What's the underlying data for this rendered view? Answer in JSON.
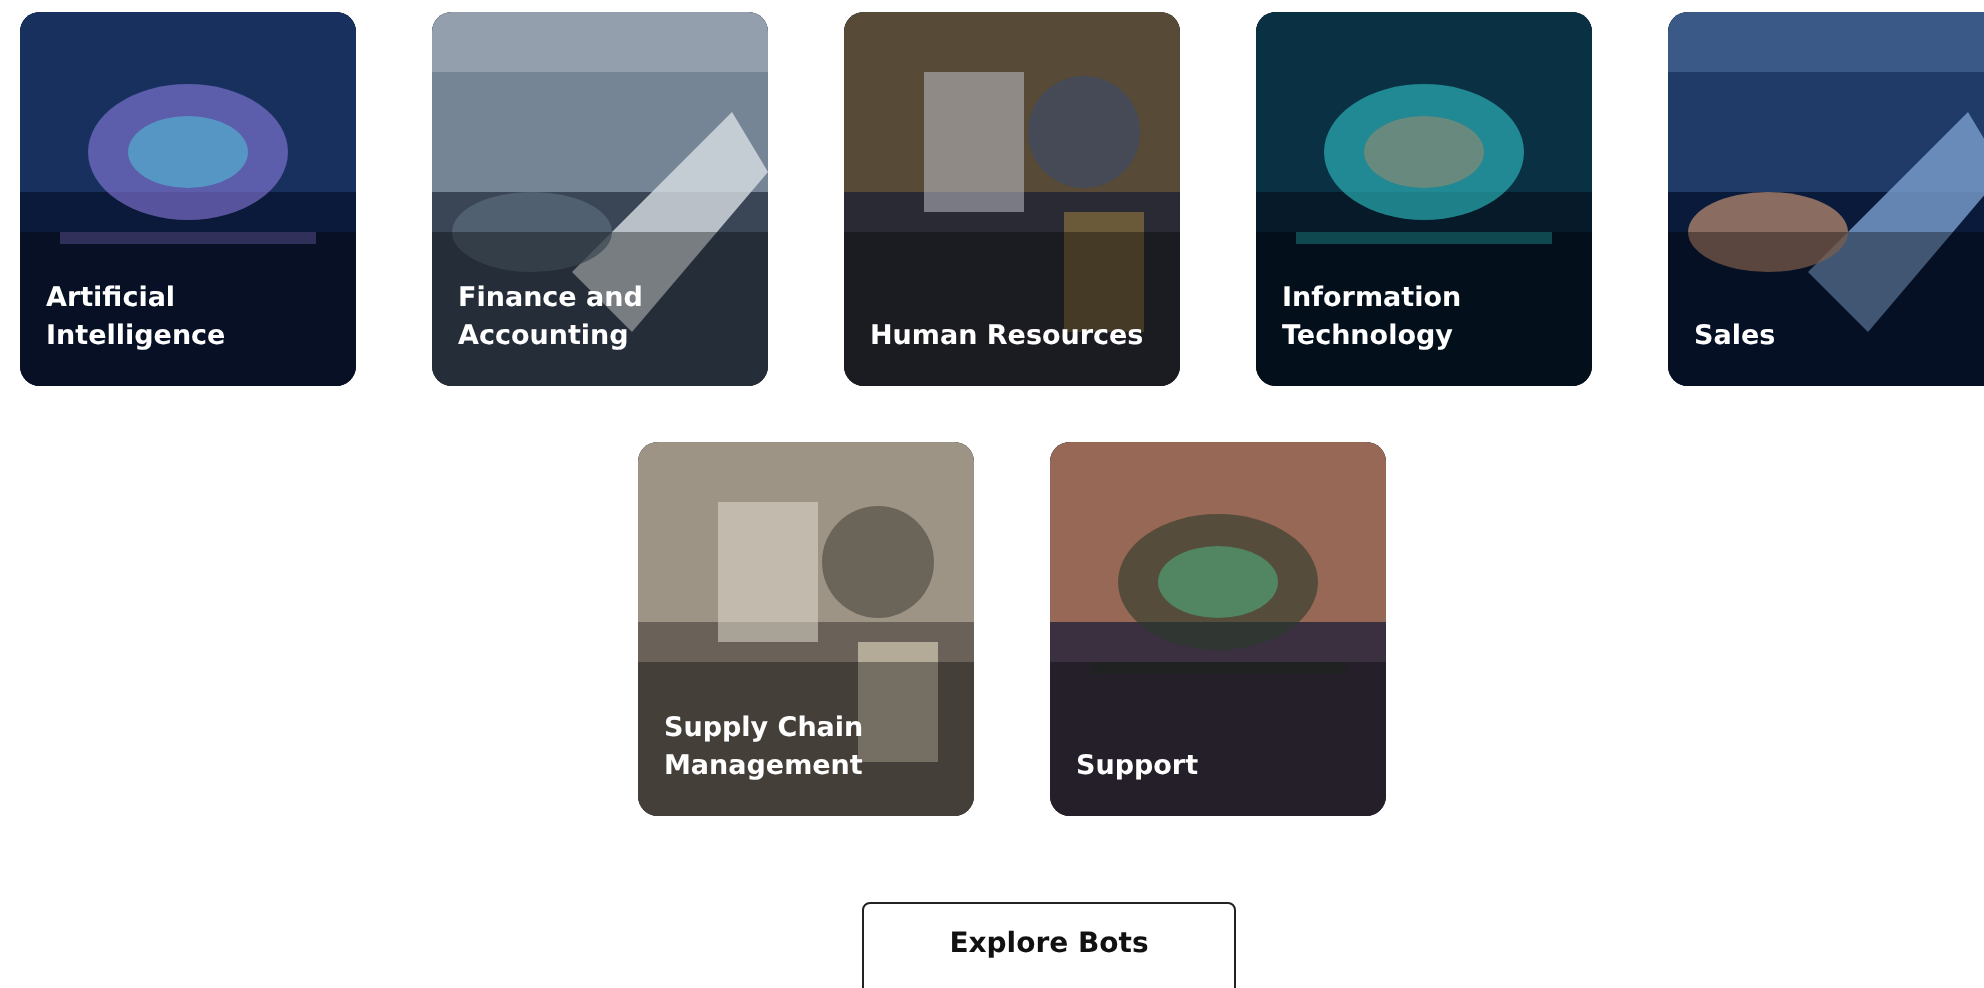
{
  "categories": [
    {
      "title": "Artificial Intelligence"
    },
    {
      "title": "Finance and Accounting"
    },
    {
      "title": "Human Resources"
    },
    {
      "title": "Information Technology"
    },
    {
      "title": "Sales"
    },
    {
      "title": "Supply Chain Management"
    },
    {
      "title": "Support"
    }
  ],
  "button": {
    "label": "Explore Bots"
  }
}
